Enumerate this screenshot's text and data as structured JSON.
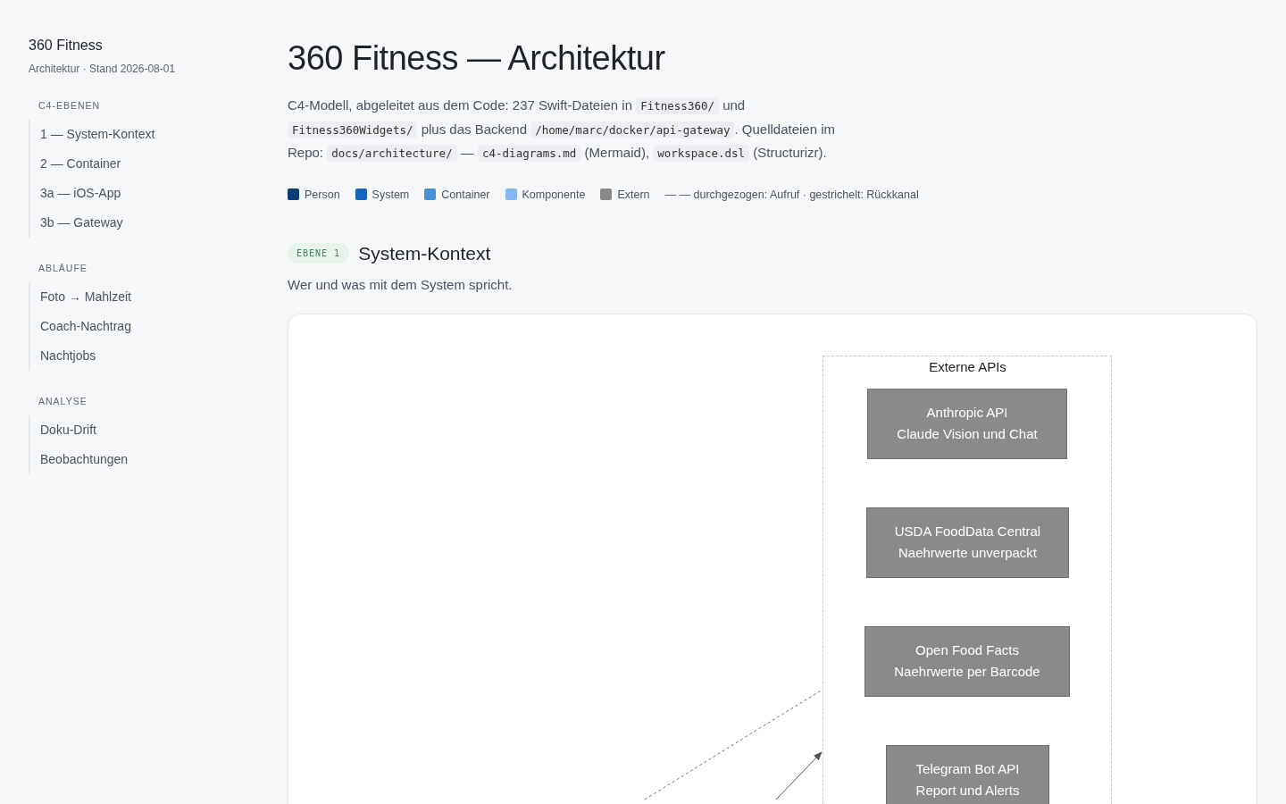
{
  "sidebar": {
    "title": "360 Fitness",
    "subtitle": "Architektur · Stand 2026-08-01",
    "groups": [
      {
        "heading": "C4-EBENEN",
        "items": [
          "1 — System-Kontext",
          "2 — Container",
          "3a — iOS-App",
          "3b — Gateway"
        ]
      },
      {
        "heading": "ABLÄUFE",
        "items": [
          "Foto → Mahlzeit",
          "Coach-Nachtrag",
          "Nachtjobs"
        ]
      },
      {
        "heading": "ANALYSE",
        "items": [
          "Doku-Drift",
          "Beobachtungen"
        ]
      }
    ]
  },
  "page": {
    "title": "360 Fitness — Architektur",
    "intro": [
      {
        "kind": "text",
        "text": "C4-Modell, abgeleitet aus dem Code: 237 Swift-Dateien in "
      },
      {
        "kind": "code",
        "text": "Fitness360/"
      },
      {
        "kind": "text",
        "text": " und "
      },
      {
        "kind": "code",
        "text": "Fitness360Widgets/"
      },
      {
        "kind": "text",
        "text": " plus das Backend "
      },
      {
        "kind": "code",
        "text": "/home/marc/docker/api-gateway"
      },
      {
        "kind": "text",
        "text": ". Quelldateien im Repo: "
      },
      {
        "kind": "code",
        "text": "docs/architecture/"
      },
      {
        "kind": "text",
        "text": " — "
      },
      {
        "kind": "code",
        "text": "c4-diagrams.md"
      },
      {
        "kind": "text",
        "text": " (Mermaid), "
      },
      {
        "kind": "code",
        "text": "workspace.dsl"
      },
      {
        "kind": "text",
        "text": " (Structurizr)."
      }
    ],
    "legend": [
      {
        "label": "Person",
        "color": "#0b3d75"
      },
      {
        "label": "System",
        "color": "#1565c0"
      },
      {
        "label": "Container",
        "color": "#4a90d9"
      },
      {
        "label": "Komponente",
        "color": "#85b8f0"
      },
      {
        "label": "Extern",
        "color": "#888888"
      }
    ],
    "line_legend": "— — durchgezogen: Aufruf · gestrichelt: Rückkanal"
  },
  "section": {
    "badge": "EBENE 1",
    "title": "System-Kontext",
    "description": "Wer und was mit dem System spricht.",
    "diagram": {
      "cluster": "Externe APIs",
      "nodes": [
        {
          "lines": [
            "Anthropic API",
            "Claude Vision und Chat"
          ]
        },
        {
          "lines": [
            "USDA FoodData Central",
            "Naehrwerte unverpackt"
          ]
        },
        {
          "lines": [
            "Open Food Facts",
            "Naehrwerte per Barcode"
          ]
        },
        {
          "lines": [
            "Telegram Bot API",
            "Report und Alerts"
          ]
        }
      ],
      "edges": [
        {
          "kind": "dashed"
        },
        {
          "kind": "solid"
        }
      ]
    }
  }
}
